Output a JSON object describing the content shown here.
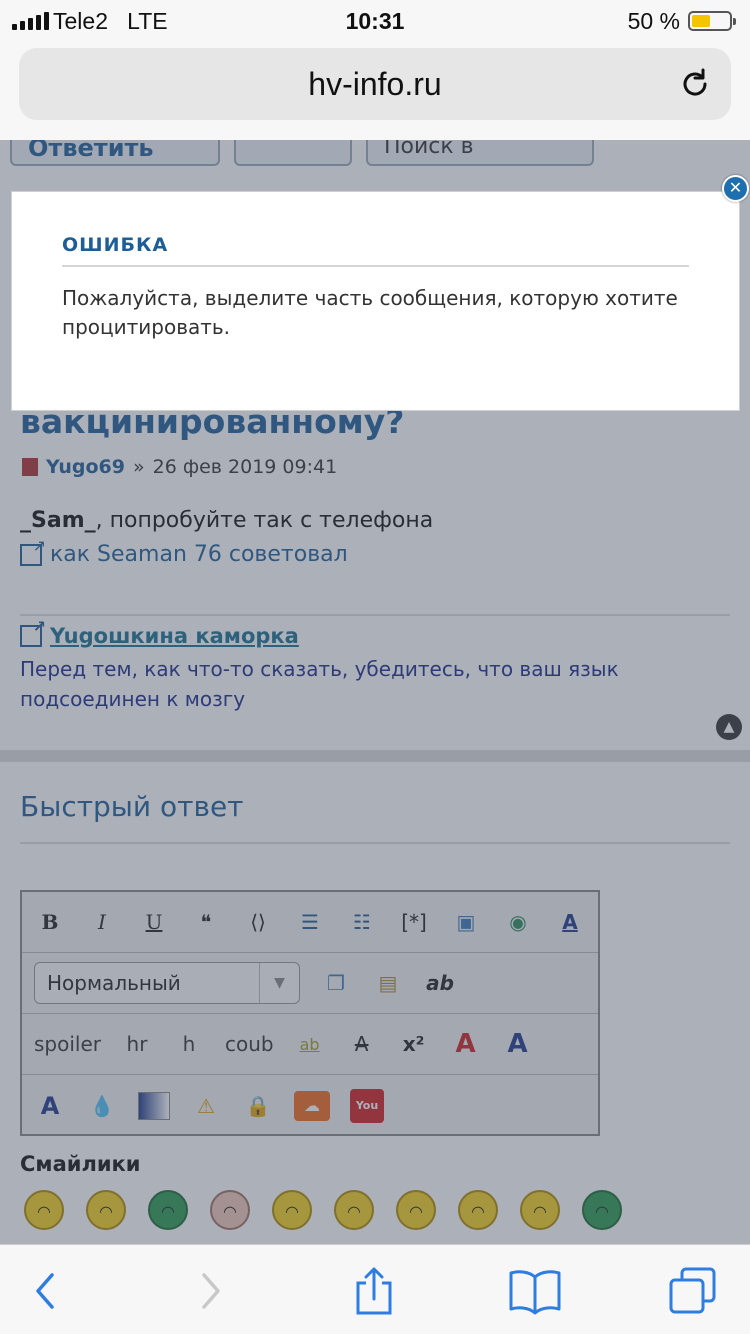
{
  "status_bar": {
    "carrier": "Tele2",
    "network": "LTE",
    "time": "10:31",
    "battery_percent": "50 %",
    "battery_level": 0.5,
    "battery_color": "#f4c400"
  },
  "browser": {
    "url": "hv-info.ru",
    "reload_icon": "reload-icon"
  },
  "toolbar": {
    "reply_label": "Ответить",
    "search_placeholder": "Поиск в"
  },
  "post": {
    "title": "вакцинированному?",
    "author": "Yugo69",
    "separator": "»",
    "date": "26 фев 2019 09:41",
    "mention": "_Sam_",
    "body": ", попробуйте так с телефона",
    "link_text": "как Seaman 76 советовал"
  },
  "signature": {
    "link_text": "Yugoшкина каморка",
    "text": "Перед тем, как что-то сказать, убедитесь, что ваш язык подсоединен к мозгу"
  },
  "quick_reply": {
    "title": "Быстрый ответ",
    "format_select": "Нормальный",
    "text_buttons": [
      "spoiler",
      "hr",
      "h",
      "coub"
    ],
    "smilies_title": "Смайлики"
  },
  "modal": {
    "title": "ОШИБКА",
    "message": "Пожалуйста, выделите часть сообщения, которую хотите процитировать.",
    "close_icon": "close-icon"
  },
  "colors": {
    "accent": "#1e5e96",
    "overlay": "rgba(70,80,100,0.45)",
    "ios_blue": "#2f7de1"
  }
}
